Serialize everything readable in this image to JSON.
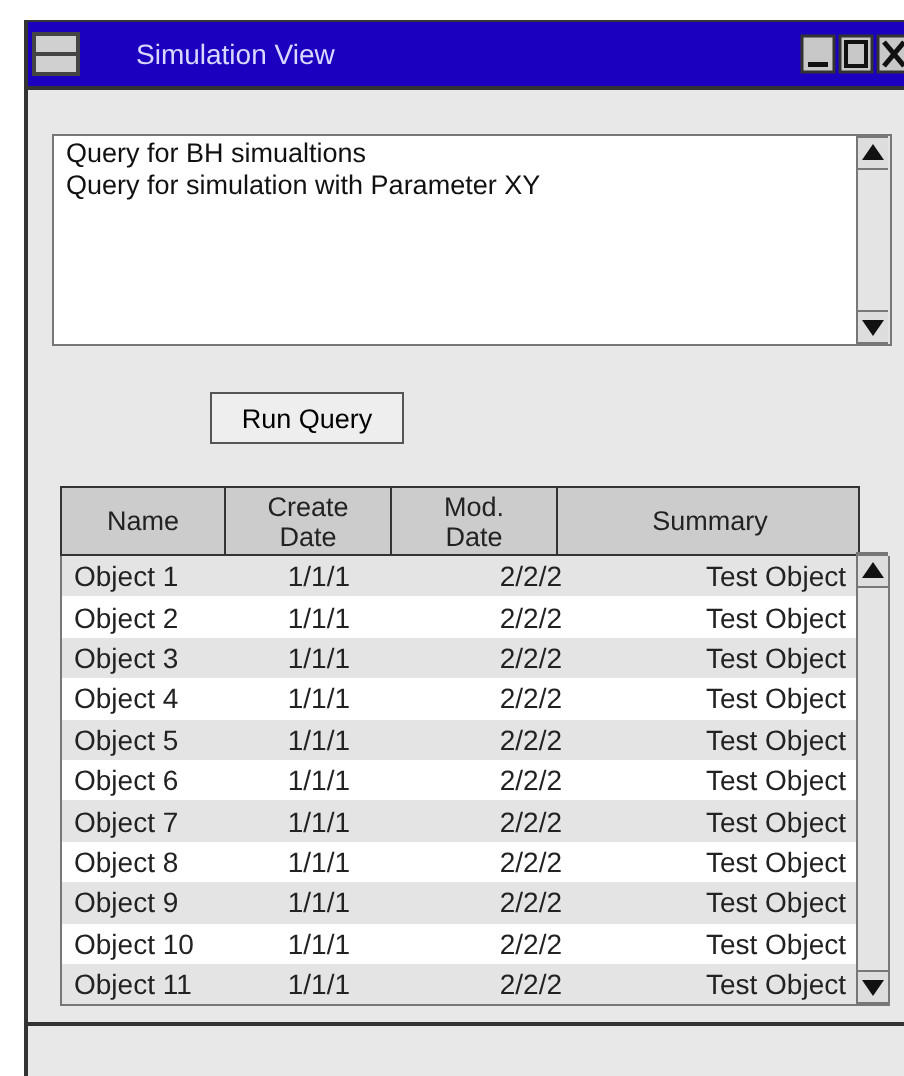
{
  "window": {
    "title": "Simulation View"
  },
  "queries": [
    "Query for BH simualtions",
    "Query for simulation with Parameter XY"
  ],
  "run_button": "Run Query",
  "table": {
    "columns": [
      "Name",
      "Create Date",
      "Mod. Date",
      "Summary"
    ],
    "rows": [
      [
        "Object 1",
        "1/1/1",
        "2/2/2",
        "Test Object"
      ],
      [
        "Object 2",
        "1/1/1",
        "2/2/2",
        "Test Object"
      ],
      [
        "Object 3",
        "1/1/1",
        "2/2/2",
        "Test Object"
      ],
      [
        "Object 4",
        "1/1/1",
        "2/2/2",
        "Test Object"
      ],
      [
        "Object 5",
        "1/1/1",
        "2/2/2",
        "Test Object"
      ],
      [
        "Object 6",
        "1/1/1",
        "2/2/2",
        "Test Object"
      ],
      [
        "Object 7",
        "1/1/1",
        "2/2/2",
        "Test Object"
      ],
      [
        "Object 8",
        "1/1/1",
        "2/2/2",
        "Test Object"
      ],
      [
        "Object 9",
        "1/1/1",
        "2/2/2",
        "Test Object"
      ],
      [
        "Object 10",
        "1/1/1",
        "2/2/2",
        "Test Object"
      ],
      [
        "Object 11",
        "1/1/1",
        "2/2/2",
        "Test Object"
      ]
    ]
  }
}
